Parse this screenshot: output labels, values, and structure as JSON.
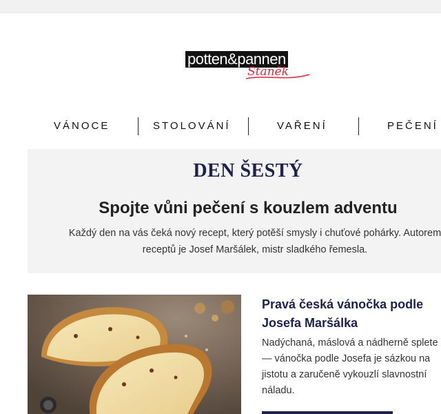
{
  "brand": {
    "logo_text": "potten&pannen",
    "logo_script": "Staněk"
  },
  "nav": {
    "items": [
      "VÁNOCE",
      "STOLOVÁNÍ",
      "VAŘENÍ",
      "PEČENÍ"
    ]
  },
  "banner": {
    "title": "DEN ŠESTÝ",
    "subtitle": "Spojte vůni pečení s kouzlem adventu",
    "text_lines": [
      "Každý den na vás čeká nový recept, který potěší smysly i chuťové pohárky. Autorem",
      "receptů je Josef Maršálek, mistr sladkého řemesla."
    ]
  },
  "article": {
    "title_lines": [
      "Pravá česká vánočka podle",
      "Josefa Maršálka"
    ],
    "desc_lines": [
      "Nadýchaná, máslová a nádherně splete",
      "— vánočka podle Josefa je sázkou na",
      "jistotu a zaručeně vykouzlí slavnostní",
      "náladu."
    ]
  },
  "colors": {
    "accent_navy": "#1e2150",
    "logo_red": "#e3263a",
    "banner_bg": "#f3f3f3"
  }
}
